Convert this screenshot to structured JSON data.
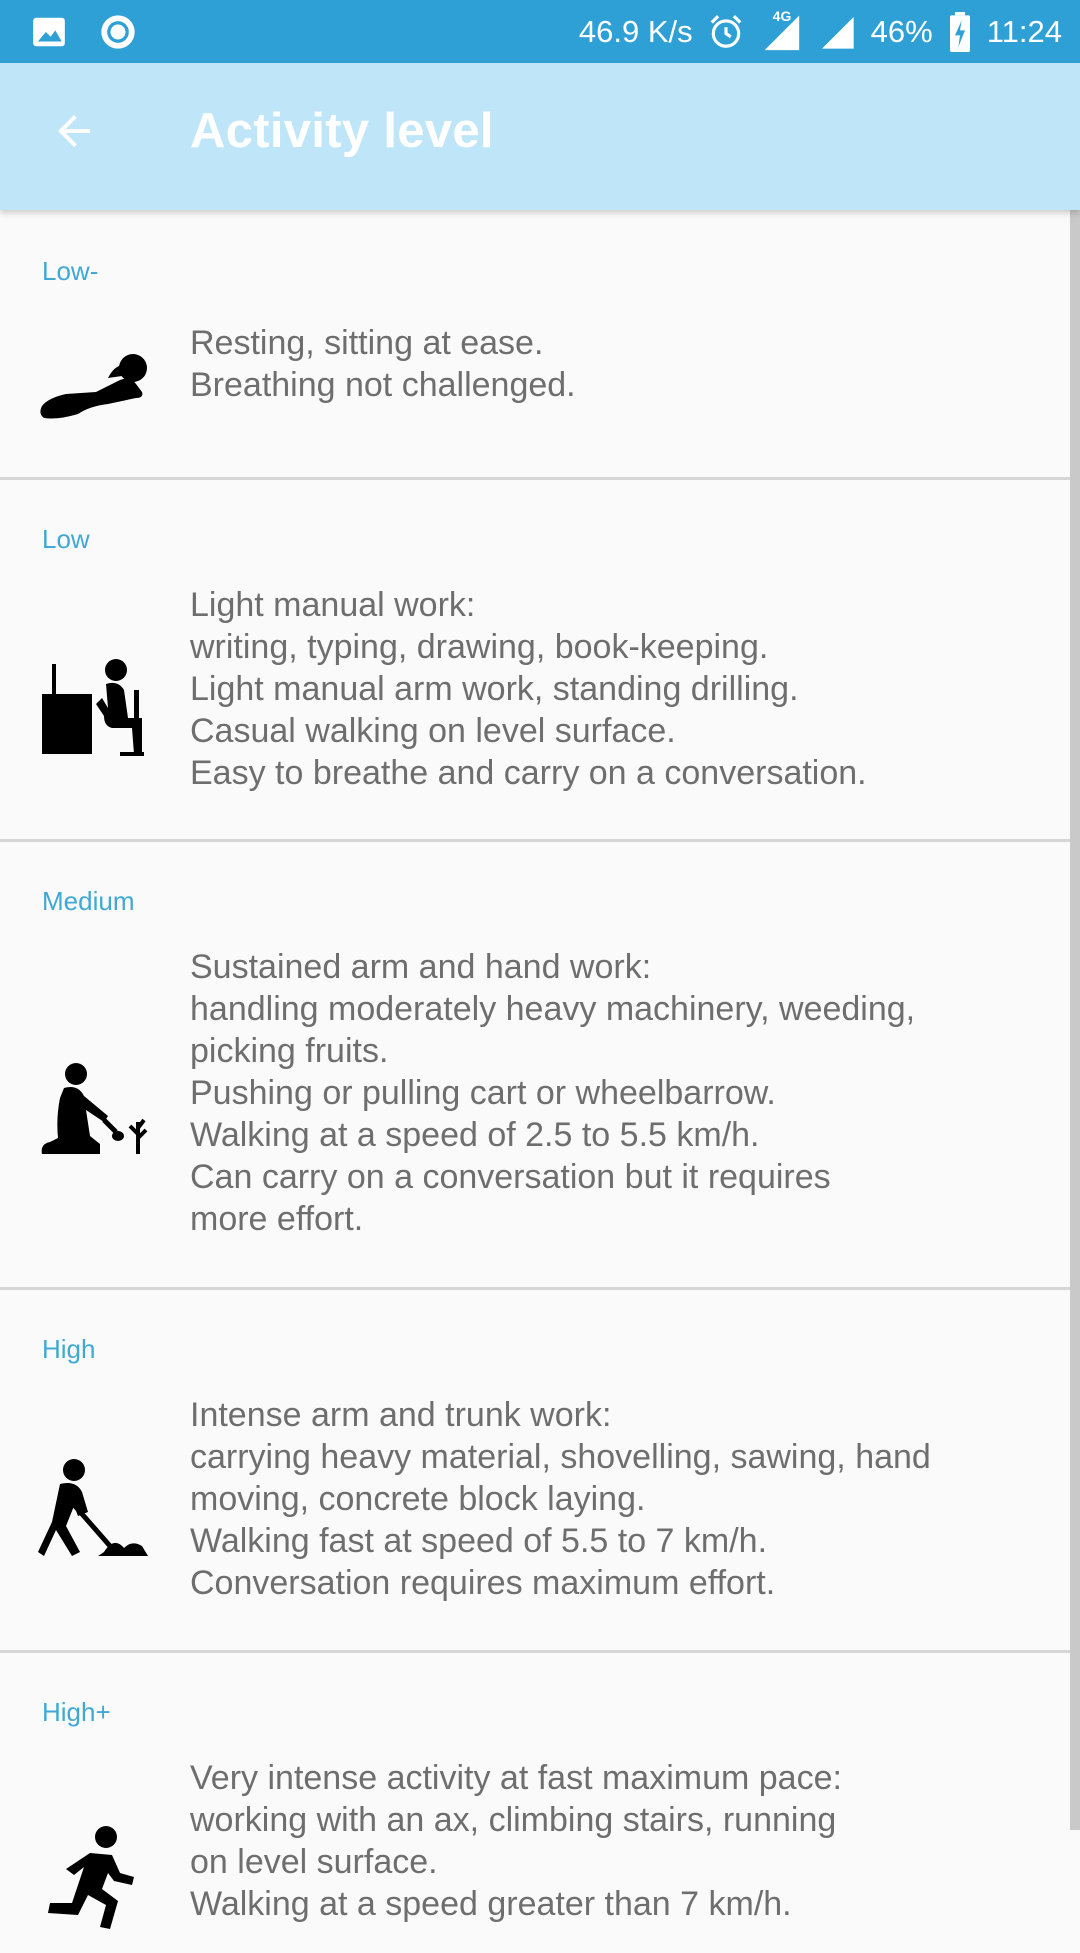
{
  "status_bar": {
    "network_speed": "46.9 K/s",
    "network_type": "4G",
    "battery": "46%",
    "time": "11:24",
    "icons": [
      "image-icon",
      "record-icon",
      "alarm-icon",
      "signal-icon",
      "battery-charging-icon"
    ]
  },
  "app_bar": {
    "title": "Activity level",
    "back_icon": "arrow-back-icon"
  },
  "colors": {
    "status_bar": "#2fa0d6",
    "app_bar": "#bfe6f8",
    "label": "#3fa9d4",
    "text": "#6e6e6e"
  },
  "levels": [
    {
      "label": "Low-",
      "icon": "resting-person-icon",
      "lines": [
        "Resting, sitting at ease.",
        "Breathing not challenged."
      ]
    },
    {
      "label": "Low",
      "icon": "desk-worker-icon",
      "lines": [
        "Light manual work:",
        "writing, typing, drawing, book-keeping.",
        "Light manual arm work, standing drilling.",
        "Casual walking on level surface.",
        "Easy to breathe and carry on a conversation."
      ]
    },
    {
      "label": "Medium",
      "icon": "gardening-person-icon",
      "lines": [
        "Sustained arm and hand work:",
        "handling moderately heavy machinery, weeding,",
        "picking fruits.",
        "Pushing or pulling cart or wheelbarrow.",
        "Walking at a speed of 2.5 to 5.5 km/h.",
        "Can carry on a conversation but it requires",
        "more effort."
      ]
    },
    {
      "label": "High",
      "icon": "shovelling-person-icon",
      "lines": [
        "Intense arm and trunk work:",
        "carrying heavy material, shovelling, sawing, hand",
        "moving, concrete block laying.",
        "Walking fast at speed of 5.5 to 7 km/h.",
        "Conversation requires maximum effort."
      ]
    },
    {
      "label": "High+",
      "icon": "running-person-icon",
      "lines": [
        "Very intense activity at fast maximum pace:",
        "working with an ax, climbing stairs, running",
        "on level surface.",
        "Walking at a speed greater than 7 km/h."
      ]
    }
  ]
}
